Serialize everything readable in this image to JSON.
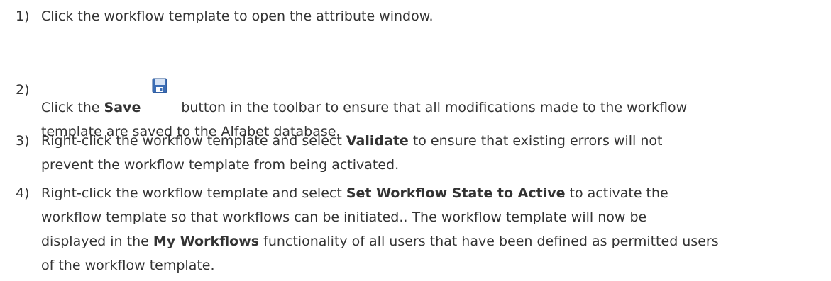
{
  "steps": [
    {
      "number": "1)",
      "text": "Click the workflow template to open the attribute window."
    },
    {
      "number": "2)",
      "pre": "Click the ",
      "bold": "Save",
      "icon": "save-icon",
      "post": "button in the toolbar to ensure that all modifications made to the workflow",
      "line2": "template are saved to the Alfabet database."
    },
    {
      "number": "3)",
      "pre": "Right-click the workflow template and select ",
      "bold": "Validate",
      "post": " to ensure that existing errors will not",
      "line2": "prevent the workflow template from being activated."
    },
    {
      "number": "4)",
      "pre": "Right-click the workflow template and select ",
      "bold": "Set Workflow State to Active",
      "post": " to activate the",
      "line2": "workflow template so that workflows can be initiated.. The workflow template will now be",
      "line3_pre": "displayed in the ",
      "line3_bold": "My Workflows",
      "line3_post": " functionality of all users that have been defined as permitted users",
      "line4": "of the workflow template."
    }
  ],
  "colors": {
    "text": "#333333",
    "icon_blue": "#3b6db5",
    "icon_light": "#d6e3f5"
  }
}
